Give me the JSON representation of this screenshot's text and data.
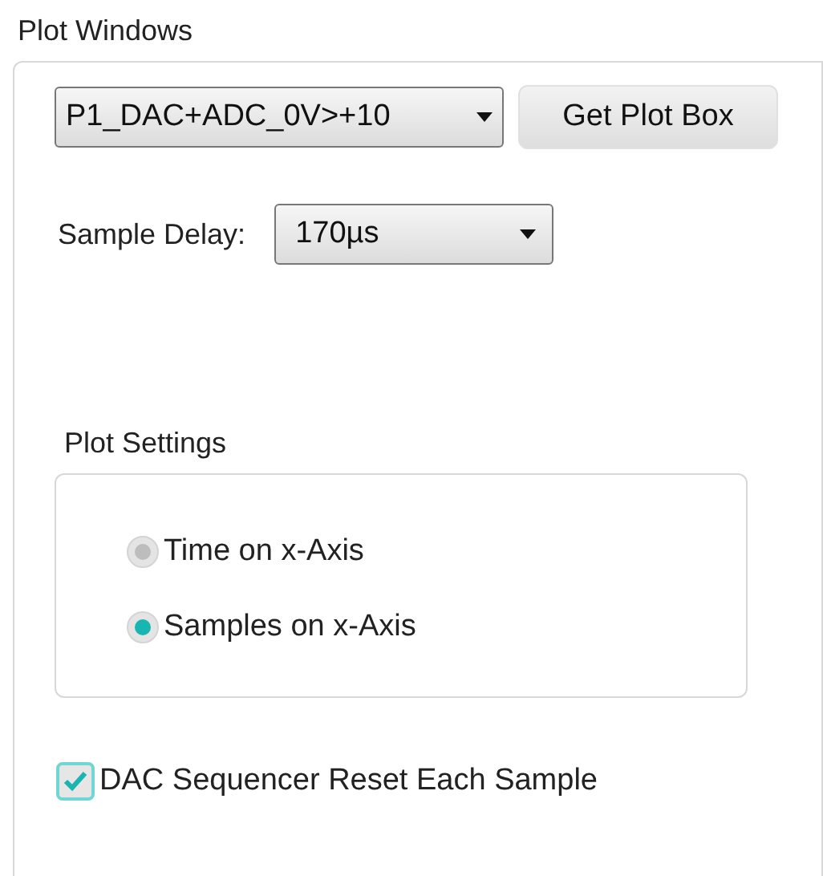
{
  "title": "Plot Windows",
  "plot_window_select": {
    "value": "P1_DAC+ADC_0V>+10"
  },
  "get_plot_box_button": "Get Plot Box",
  "sample_delay": {
    "label": "Sample Delay:",
    "value": "170µs"
  },
  "plot_settings": {
    "title": "Plot Settings",
    "options": [
      {
        "label": "Time on x-Axis",
        "selected": false
      },
      {
        "label": "Samples on x-Axis",
        "selected": true
      }
    ]
  },
  "dac_reset": {
    "label": "DAC Sequencer Reset Each Sample",
    "checked": true
  }
}
